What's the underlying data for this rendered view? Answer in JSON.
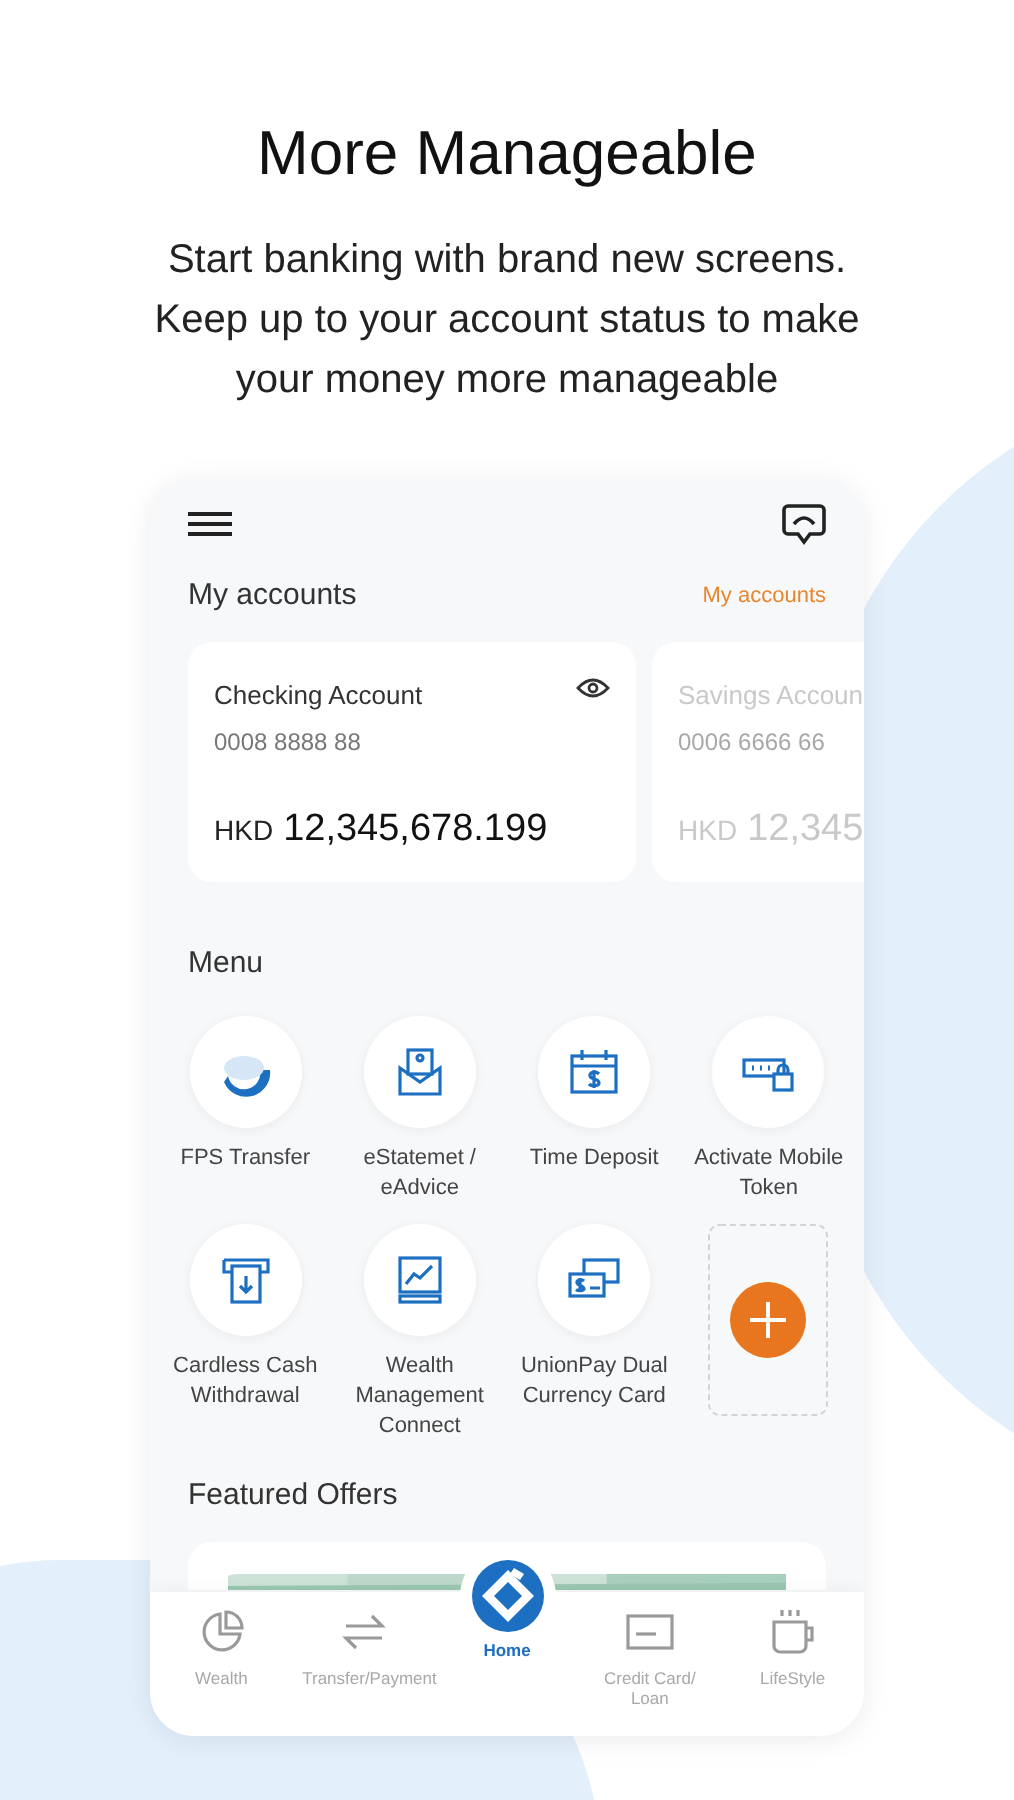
{
  "heading": "More Manageable",
  "subtitle": "Start banking with brand new screens. Keep up to your account status to make your money more manageable",
  "app": {
    "accounts_title": "My accounts",
    "accounts_link": "My accounts",
    "accounts": [
      {
        "name": "Checking Account",
        "number": "0008 8888 88",
        "currency": "HKD",
        "amount": "12,345,678.199",
        "dimmed": false
      },
      {
        "name": "Savings Accoun",
        "number": "0006 6666 66",
        "currency": "HKD",
        "amount": "12,345",
        "dimmed": true
      }
    ],
    "menu_title": "Menu",
    "menu": [
      {
        "kind": "fps",
        "label": "FPS Transfer"
      },
      {
        "kind": "statement",
        "label": "eStatemet / eAdvice"
      },
      {
        "kind": "deposit",
        "label": "Time Deposit"
      },
      {
        "kind": "token",
        "label": "Activate Mobile Token"
      },
      {
        "kind": "cardless",
        "label": "Cardless Cash Withdrawal"
      },
      {
        "kind": "wealth",
        "label": "Wealth Management Connect"
      },
      {
        "kind": "unionpay",
        "label": "UnionPay Dual Currency Card"
      },
      {
        "kind": "add"
      }
    ],
    "featured_title": "Featured Offers",
    "tabs": [
      {
        "kind": "wealth",
        "label": "Wealth",
        "selected": false
      },
      {
        "kind": "transfer",
        "label": "Transfer/Payment",
        "selected": false
      },
      {
        "kind": "home",
        "label": "Home",
        "selected": true
      },
      {
        "kind": "card",
        "label": "Credit Card/ Loan",
        "selected": false
      },
      {
        "kind": "lifestyle",
        "label": "LifeStyle",
        "selected": false
      }
    ]
  }
}
